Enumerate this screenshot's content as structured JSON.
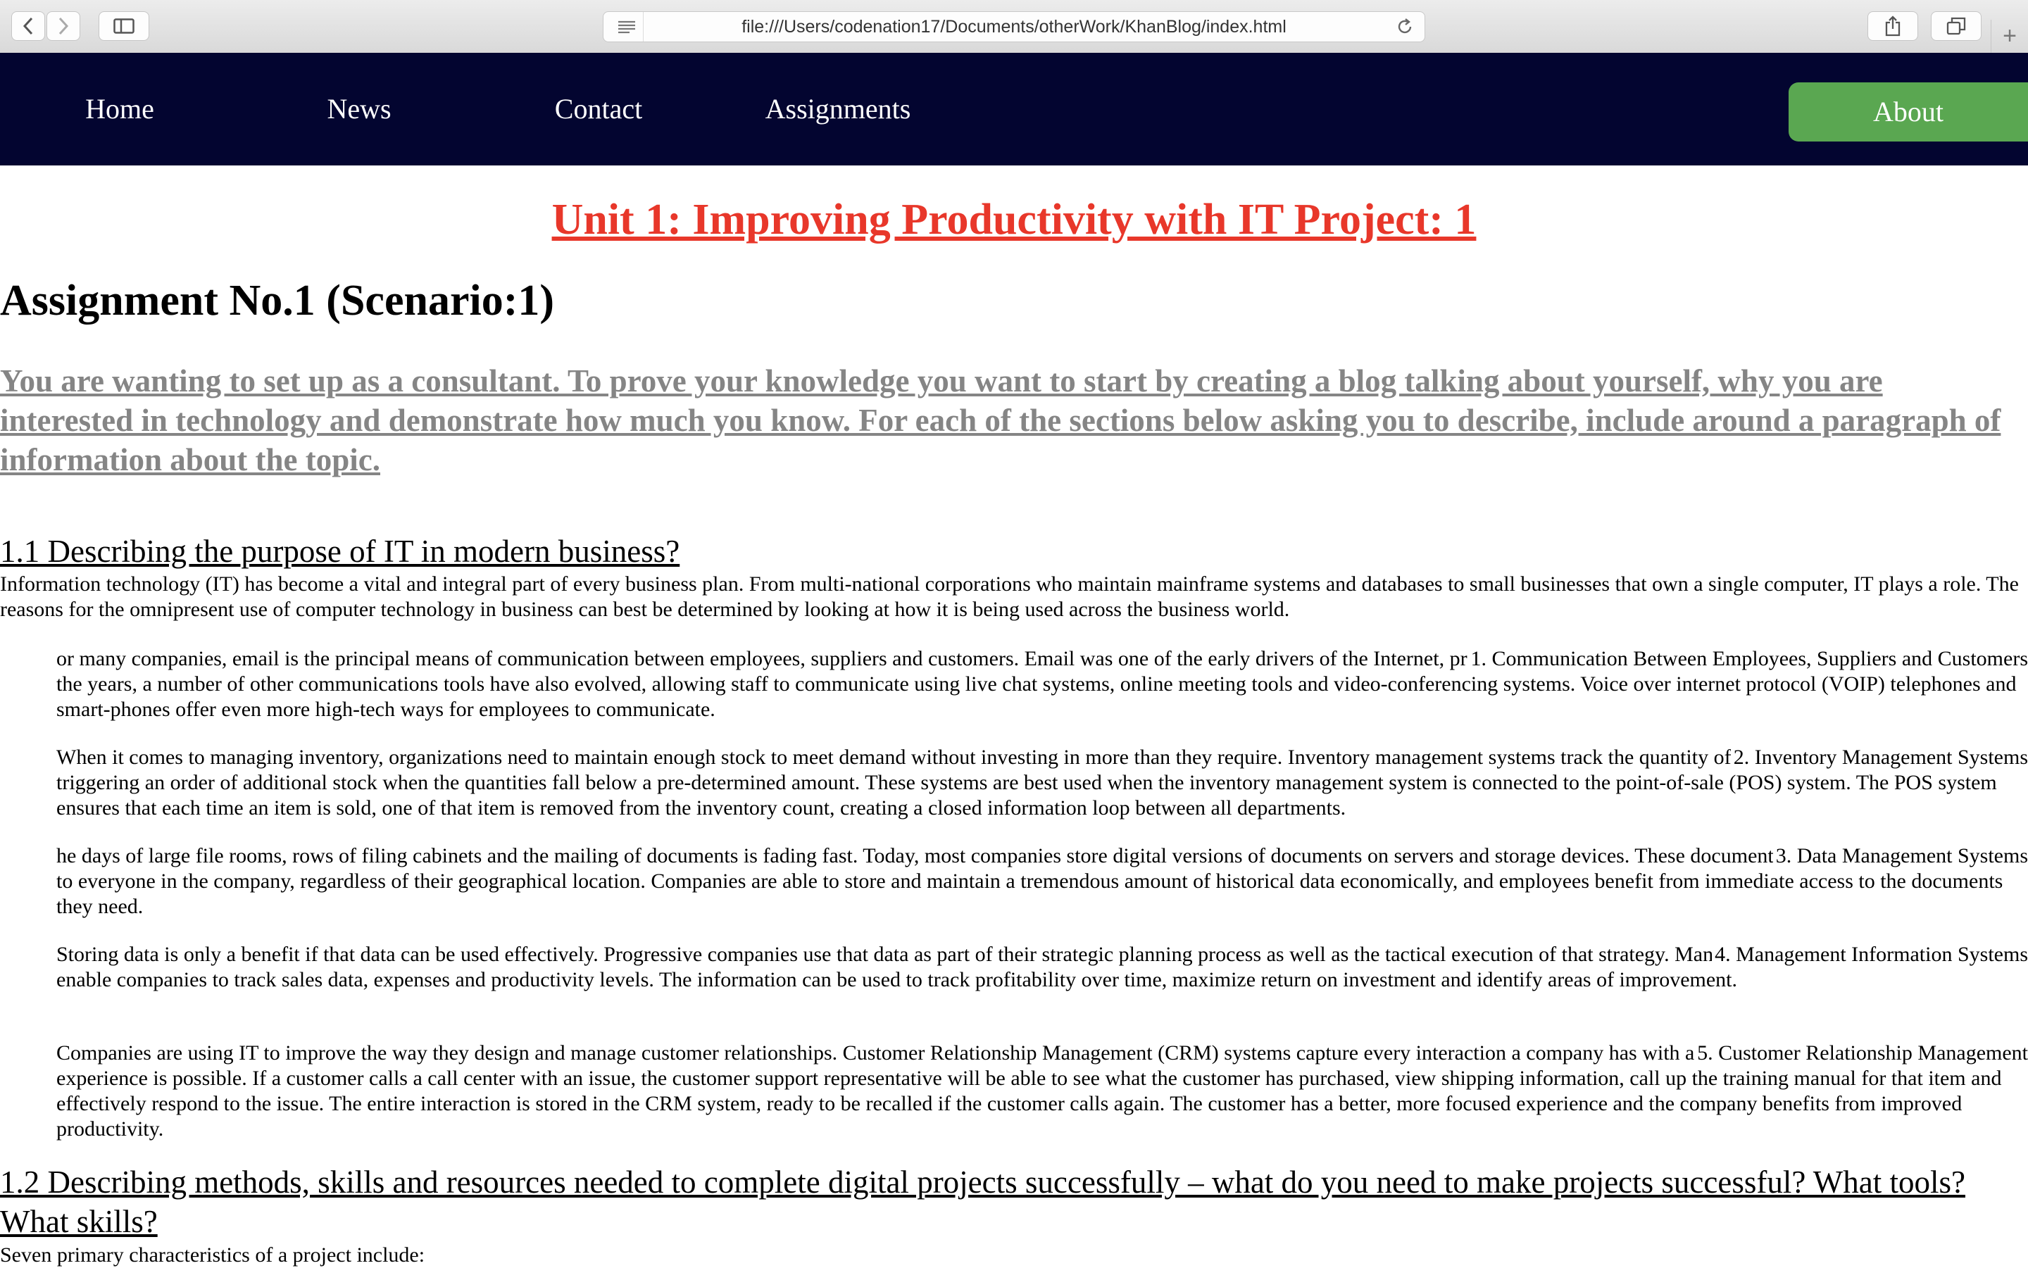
{
  "browser": {
    "url": "file:///Users/codenation17/Documents/otherWork/KhanBlog/index.html",
    "new_tab": "+"
  },
  "nav": {
    "home": "Home",
    "news": "News",
    "contact": "Contact",
    "assignments": "Assignments",
    "about": "About"
  },
  "page": {
    "unit_title": "Unit 1: Improving Productivity with IT Project: 1",
    "assignment_title": "Assignment No.1 (Scenario:1)",
    "intro": "You are wanting to set up as a consultant. To prove your knowledge you want to start by creating a blog talking about yourself, why you are interested in technology and demonstrate how much you know. For each of the sections below asking you to describe, include around a paragraph of information about the topic.",
    "section1_heading": "1.1 Describing the purpose of IT in modern business?",
    "section1_intro": "Information technology (IT) has become a vital and integral part of every business plan. From multi-national corporations who maintain mainframe systems and databases to small businesses that own a single computer, IT plays a role. The reasons for the omnipresent use of computer technology in business can best be determined by looking at how it is being used across the business world.",
    "items": [
      {
        "text": "or many companies, email is the principal means of communication between employees, suppliers and customers. Email was one of the early drivers of the Internet, providing a simple and inexpensive means to communicate. Over the years, a number of other communications tools have also evolved, allowing staff to communicate using live chat systems, online meeting tools and video-conferencing systems. Voice over internet protocol (VOIP) telephones and smart-phones offer even more high-tech ways for employees to communicate.",
        "tag": "1.  Communication Between Employees, Suppliers and Customers"
      },
      {
        "text": "When it comes to managing inventory, organizations need to maintain enough stock to meet demand without investing in more than they require. Inventory management systems track the quantity of each item a company maintains, triggering an order of additional stock when the quantities fall below a pre-determined amount. These systems are best used when the inventory management system is connected to the point-of-sale (POS) system. The POS system ensures that each time an item is sold, one of that item is removed from the inventory count, creating a closed information loop between all departments.",
        "tag": "2.  Inventory Management Systems"
      },
      {
        "text": "he days of large file rooms, rows of filing cabinets and the mailing of documents is fading fast. Today, most companies store digital versions of documents on servers and storage devices. These documents become instantly available to everyone in the company, regardless of their geographical location. Companies are able to store and maintain a tremendous amount of historical data economically, and employees benefit from immediate access to the documents they need.",
        "tag": "3.  Data Management Systems"
      },
      {
        "text": "Storing data is only a benefit if that data can be used effectively. Progressive companies use that data as part of their strategic planning process as well as the tactical execution of that strategy. Management Information Systems (MIS) enable companies to track sales data, expenses and productivity levels. The information can be used to track profitability over time, maximize return on investment and identify areas of improvement.",
        "tag": "4.  Management Information Systems"
      },
      {
        "text": "Companies are using IT to improve the way they design and manage customer relationships. Customer Relationship Management (CRM) systems capture every interaction a company has with a customer, so that a more enriching experience is possible. If a customer calls a call center with an issue, the customer support representative will be able to see what the customer has purchased, view shipping information, call up the training manual for that item and effectively respond to the issue. The entire interaction is stored in the CRM system, ready to be recalled if the customer calls again. The customer has a better, more focused experience and the company benefits from improved productivity.",
        "tag": "5.  Customer Relationship Management"
      }
    ],
    "section2_heading": "1.2 Describing methods, skills and resources needed to complete digital projects successfully – what do you need to make projects successful? What tools? What skills?",
    "section2_intro": "Seven primary characteristics of a project include:"
  },
  "colors": {
    "navbar": "#030530",
    "about_button": "#5aa751",
    "unit_title": "#e8372a",
    "intro_text": "#858585"
  },
  "icons": [
    "back-icon",
    "forward-icon",
    "sidebar-icon",
    "reader-icon",
    "reload-icon",
    "share-icon",
    "tabs-icon",
    "plus-icon"
  ]
}
